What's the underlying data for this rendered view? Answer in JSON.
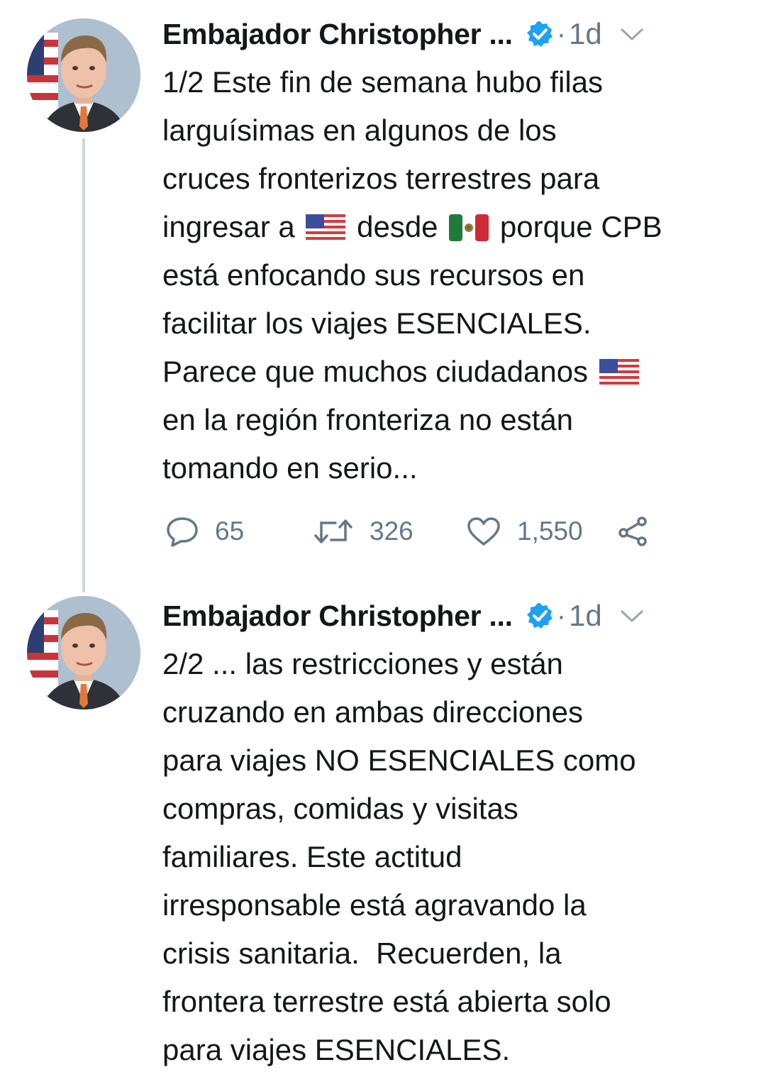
{
  "colors": {
    "text": "#14171a",
    "secondary": "#657786",
    "verified": "#1da1f2",
    "thread_line": "#ccd6dd"
  },
  "tweets": [
    {
      "author_name": "Embajador Christopher ...",
      "verified": true,
      "dot": "·",
      "time": "1d",
      "text_parts": {
        "p1": "1/2 Este fin de semana hubo filas\nlarguísimas en algunos de los\ncruces fronterizos terrestres para\ningresar a ",
        "p2": " desde ",
        "p3": " porque CPB\nestá enfocando sus recursos en\nfacilitar los viajes ESENCIALES.\nParece que muchos ciudadanos ",
        "p4": "\nen la región fronteriza no están\ntomando en serio..."
      },
      "emojis": [
        "flag-us",
        "flag-mexico",
        "flag-us"
      ],
      "actions": {
        "replies": "65",
        "retweets": "326",
        "likes": "1,550"
      },
      "icons": [
        "reply-icon",
        "retweet-icon",
        "like-icon",
        "share-icon",
        "chevron-down-icon",
        "verified-badge-icon"
      ]
    },
    {
      "author_name": "Embajador Christopher ...",
      "verified": true,
      "dot": "·",
      "time": "1d",
      "text": "2/2 ... las restricciones y están\ncruzando en ambas direcciones\npara viajes NO ESENCIALES como\ncompras, comidas y visitas\nfamiliares. Este actitud\nirresponsable está agravando la\ncrisis sanitaria.  Recuerden, la\nfrontera terrestre está abierta solo\npara viajes ESENCIALES."
    }
  ]
}
